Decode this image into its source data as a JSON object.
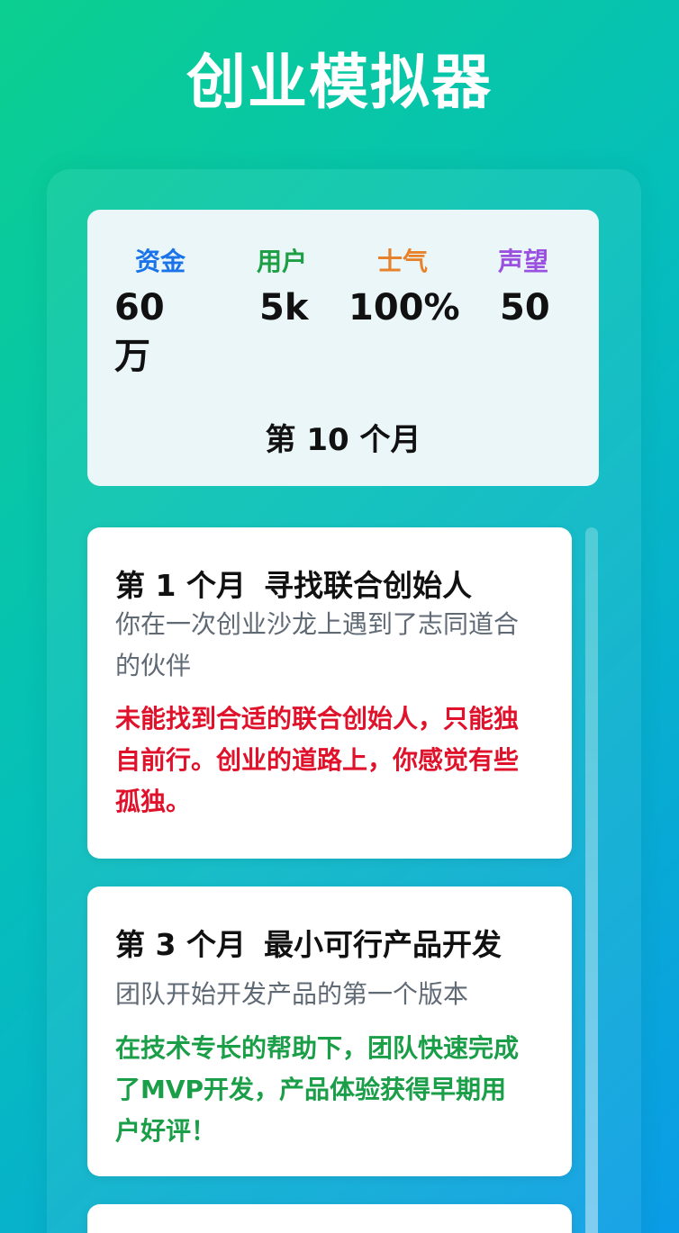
{
  "app": {
    "title": "创业模拟器"
  },
  "stats": [
    {
      "label": "资金",
      "value": "60万",
      "color": "#1a73e8"
    },
    {
      "label": "用户",
      "value": "5k",
      "color": "#1e9e45"
    },
    {
      "label": "士气",
      "value": "100%",
      "color": "#e8822a"
    },
    {
      "label": "声望",
      "value": "50",
      "color": "#9b51e0"
    }
  ],
  "current_month": "第 10 个月",
  "events": [
    {
      "month": "第 1 个月",
      "title": "寻找联合创始人",
      "description": "你在一次创业沙龙上遇到了志同道合的伙伴",
      "result": "未能找到合适的联合创始人，只能独自前行。创业的道路上，你感觉有些孤独。",
      "result_color": "#e0122b"
    },
    {
      "month": "第 3 个月",
      "title": "最小可行产品开发",
      "description": "团队开始开发产品的第一个版本",
      "result": "在技术专长的帮助下，团队快速完成了MVP开发，产品体验获得早期用户好评！",
      "result_color": "#1a9e48"
    }
  ]
}
